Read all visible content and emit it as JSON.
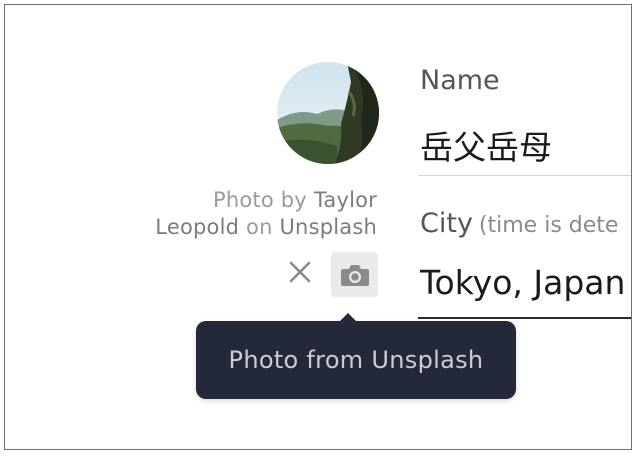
{
  "avatar": {
    "icon": "avatar-photo"
  },
  "credit": {
    "photo_by": "Photo by",
    "author_first": "Taylor",
    "author_last": "Leopold",
    "on": "on",
    "source": "Unsplash"
  },
  "actions": {
    "remove_icon": "close-icon",
    "camera_icon": "camera-icon"
  },
  "tooltip": {
    "text": "Photo from Unsplash"
  },
  "fields": {
    "name": {
      "label": "Name",
      "value": "岳父岳母"
    },
    "city": {
      "label": "City",
      "note": "(time is dete",
      "value": "Tokyo, Japan"
    }
  },
  "colors": {
    "tooltip_bg": "#232939",
    "tooltip_text": "#c9ccd4",
    "camera_btn_bg": "#eaeaea"
  }
}
